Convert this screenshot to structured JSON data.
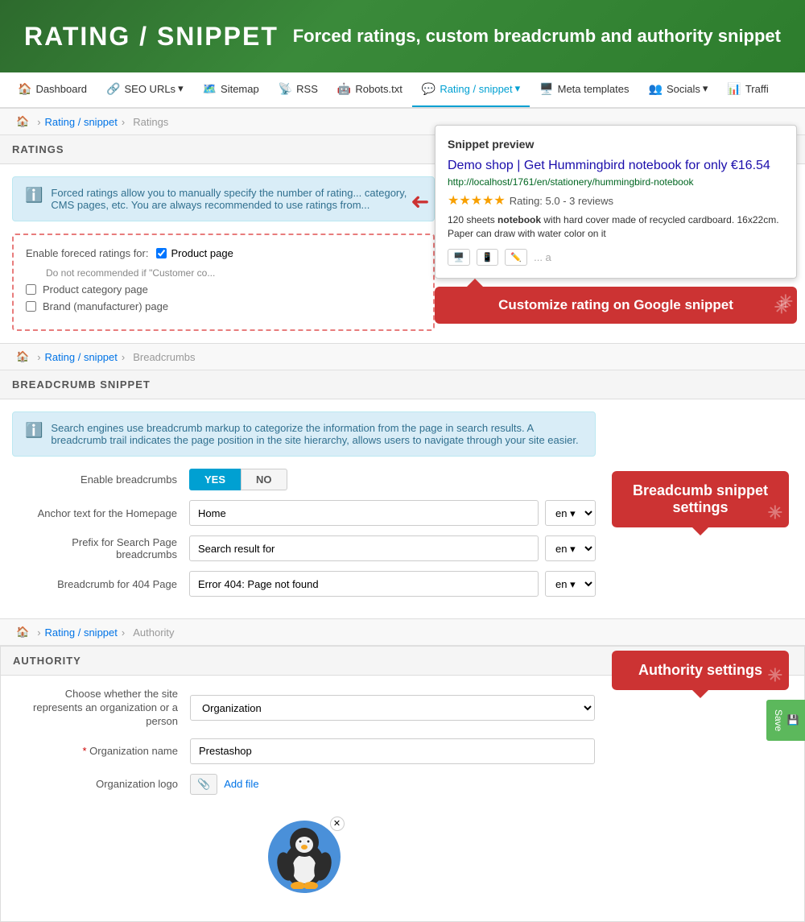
{
  "header": {
    "title": "RATING / SNIPPET",
    "subtitle": "Forced ratings, custom breadcrumb and authority snippet"
  },
  "nav": {
    "items": [
      {
        "label": "Dashboard",
        "icon": "🏠",
        "active": false
      },
      {
        "label": "SEO URLs",
        "icon": "🔗",
        "active": false,
        "hasDropdown": true
      },
      {
        "label": "Sitemap",
        "icon": "🗺️",
        "active": false
      },
      {
        "label": "RSS",
        "icon": "📡",
        "active": false
      },
      {
        "label": "Robots.txt",
        "icon": "🤖",
        "active": false
      },
      {
        "label": "Rating / snippet",
        "icon": "💬",
        "active": true,
        "hasDropdown": true
      },
      {
        "label": "Meta templates",
        "icon": "🖥️",
        "active": false
      },
      {
        "label": "Socials",
        "icon": "👥",
        "active": false,
        "hasDropdown": true
      },
      {
        "label": "Traffi",
        "icon": "📊",
        "active": false
      }
    ]
  },
  "breadcrumbs": {
    "ratings": {
      "path": [
        "🏠",
        "Rating / snippet",
        "Ratings"
      ]
    },
    "breadcrumbs_page": {
      "path": [
        "🏠",
        "Rating / snippet",
        "Breadcrumbs"
      ]
    },
    "authority_page": {
      "path": [
        "🏠",
        "Rating / snippet",
        "Authority"
      ]
    }
  },
  "ratings_section": {
    "title": "RATINGS",
    "info_text": "Forced ratings allow you to manually specify the number of rating... category, CMS pages, etc. You are always recommended to use ratings from...",
    "enable_label": "Enable foreced ratings for:",
    "product_page_label": "Product page",
    "product_page_hint": "Do not recommended if \"Customer co...",
    "product_category_label": "Product category page",
    "brand_label": "Brand (manufacturer) page"
  },
  "snippet_preview": {
    "title": "Snippet preview",
    "google_title": "Demo shop | Get Hummingbird notebook for only €16.54",
    "url": "http://localhost/1761/en/stationery/hummingbird-notebook",
    "stars": "★★★★★",
    "rating_text": "Rating: 5.0 - 3 reviews",
    "description": "120 sheets notebook with hard cover made of recycled cardboard. 16x22cm. Paper can draw with water color on it",
    "tooltip": "Customize rating on Google snippet"
  },
  "breadcrumb_section": {
    "title": "BREADCRUMB SNIPPET",
    "info_text": "Search engines use breadcrumb markup to categorize the information from the page in search results. A breadcrumb trail indicates the page position in the site hierarchy, allows users to navigate through your site easier.",
    "enable_label": "Enable breadcrumbs",
    "yes_label": "YES",
    "no_label": "NO",
    "anchor_label": "Anchor text for the Homepage",
    "anchor_value": "Home",
    "prefix_label": "Prefix for Search Page breadcrumbs",
    "prefix_value": "Search result for",
    "breadcrumb_404_label": "Breadcrumb for 404 Page",
    "breadcrumb_404_value": "Error 404: Page not found",
    "lang": "en",
    "tooltip": "Breadcumb snippet settings"
  },
  "authority_section": {
    "title": "AUTHORITY",
    "org_type_label": "Choose whether the site represents an organization or a person",
    "org_type_value": "Organization",
    "org_name_label": "Organization name",
    "org_name_required": true,
    "org_name_value": "Prestashop",
    "org_logo_label": "Organization logo",
    "add_file_label": "Add file",
    "tooltip": "Authority settings"
  },
  "save": {
    "label": "Save"
  }
}
